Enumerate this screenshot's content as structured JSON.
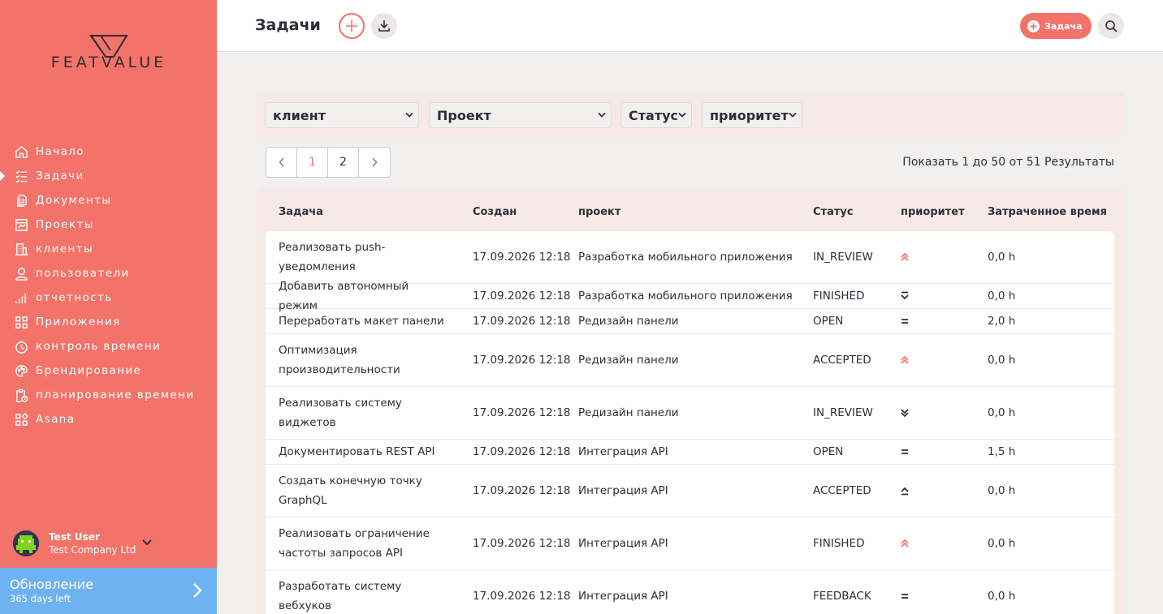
{
  "brand": {
    "name": "FEATVALUE",
    "accent": "#f3736a"
  },
  "sidebar": {
    "items": [
      {
        "label": "Начало",
        "icon": "home-icon",
        "active": false
      },
      {
        "label": "Задачи",
        "icon": "checklist-icon",
        "active": true
      },
      {
        "label": "Документы",
        "icon": "documents-icon",
        "active": false
      },
      {
        "label": "Проекты",
        "icon": "projects-icon",
        "active": false
      },
      {
        "label": "клиенты",
        "icon": "building-icon",
        "active": false
      },
      {
        "label": "пользователи",
        "icon": "user-icon",
        "active": false
      },
      {
        "label": "отчетность",
        "icon": "reporting-icon",
        "active": false
      },
      {
        "label": "Приложения",
        "icon": "apps-icon",
        "active": false
      },
      {
        "label": "контроль времени",
        "icon": "timer-icon",
        "active": false
      },
      {
        "label": "Брендирование",
        "icon": "palette-icon",
        "active": false
      },
      {
        "label": "планирование времени",
        "icon": "clipboard-clock-icon",
        "active": false
      },
      {
        "label": "Asana",
        "icon": "asana-icon",
        "active": false
      }
    ],
    "user": {
      "name": "Test User",
      "company": "Test Company Ltd"
    },
    "update": {
      "title": "Обновление",
      "subtitle": "365 days left"
    }
  },
  "header": {
    "title": "Задачи",
    "new_task_label": "Задача"
  },
  "filters": {
    "client": "клиент",
    "project": "Проект",
    "status": "Статус",
    "priority": "приоритет"
  },
  "pagination": {
    "pages": [
      "1",
      "2"
    ],
    "current": "1",
    "summary": "Показать 1 до 50 от 51 Результаты"
  },
  "table": {
    "columns": {
      "task": "Задача",
      "created": "Создан",
      "project": "проект",
      "status": "Статус",
      "priority": "приоритет",
      "time": "Затраченное время"
    },
    "rows": [
      {
        "task": "Реализовать push-уведомления",
        "created": "17.09.2026 12:18",
        "project": "Разработка мобильного приложения",
        "status": "IN_REVIEW",
        "priority": "highest",
        "time": "0,0 h"
      },
      {
        "task": "Добавить автономный режим",
        "created": "17.09.2026 12:18",
        "project": "Разработка мобильного приложения",
        "status": "FINISHED",
        "priority": "lowest",
        "time": "0,0 h"
      },
      {
        "task": "Переработать макет панели",
        "created": "17.09.2026 12:18",
        "project": "Редизайн панели",
        "status": "OPEN",
        "priority": "medium",
        "time": "2,0 h"
      },
      {
        "task": "Оптимизация производительности",
        "created": "17.09.2026 12:18",
        "project": "Редизайн панели",
        "status": "ACCEPTED",
        "priority": "highest",
        "time": "0,0 h"
      },
      {
        "task": "Реализовать систему виджетов",
        "created": "17.09.2026 12:18",
        "project": "Редизайн панели",
        "status": "IN_REVIEW",
        "priority": "low",
        "time": "0,0 h"
      },
      {
        "task": "Документировать REST API",
        "created": "17.09.2026 12:18",
        "project": "Интеграция API",
        "status": "OPEN",
        "priority": "medium",
        "time": "1,5 h"
      },
      {
        "task": "Создать конечную точку GraphQL",
        "created": "17.09.2026 12:18",
        "project": "Интеграция API",
        "status": "ACCEPTED",
        "priority": "high",
        "time": "0,0 h"
      },
      {
        "task": "Реализовать ограничение частоты запросов API",
        "created": "17.09.2026 12:18",
        "project": "Интеграция API",
        "status": "FINISHED",
        "priority": "highest",
        "time": "0,0 h"
      },
      {
        "task": "Разработать систему вебхуков",
        "created": "17.09.2026 12:18",
        "project": "Интеграция API",
        "status": "FEEDBACK",
        "priority": "medium",
        "time": "0,0 h"
      }
    ]
  }
}
